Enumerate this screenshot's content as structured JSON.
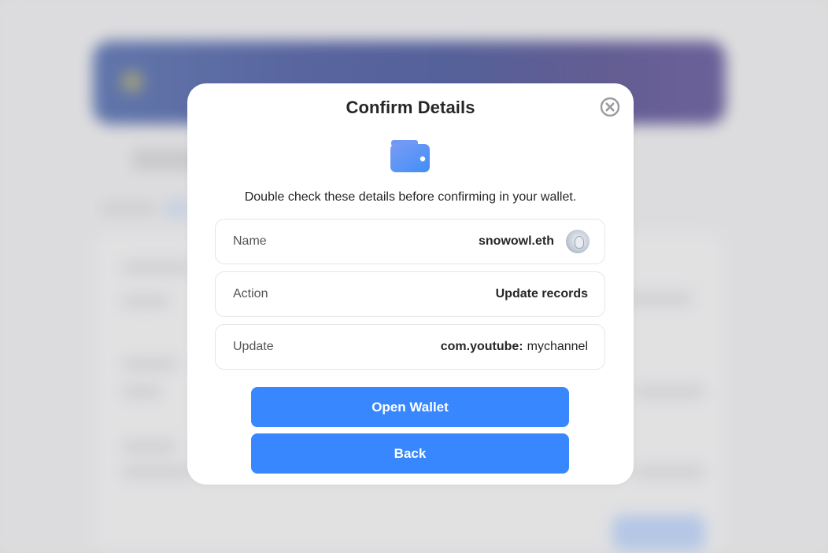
{
  "modal": {
    "title": "Confirm Details",
    "subtitle": "Double check these details before confirming in your wallet.",
    "close_icon": "close-circle-icon",
    "header_icon": "wallet-icon",
    "rows": [
      {
        "label": "Name",
        "value": "snowowl.eth",
        "avatar": "owl-avatar"
      },
      {
        "label": "Action",
        "value": "Update records"
      },
      {
        "label": "Update",
        "value_key": "com.youtube:",
        "value_text": "mychannel"
      }
    ],
    "primary_button": "Open Wallet",
    "secondary_button": "Back"
  },
  "colors": {
    "accent": "#3887ff",
    "wallet_gradient_start": "#7a9bf5",
    "wallet_gradient_end": "#3f8ff6"
  }
}
